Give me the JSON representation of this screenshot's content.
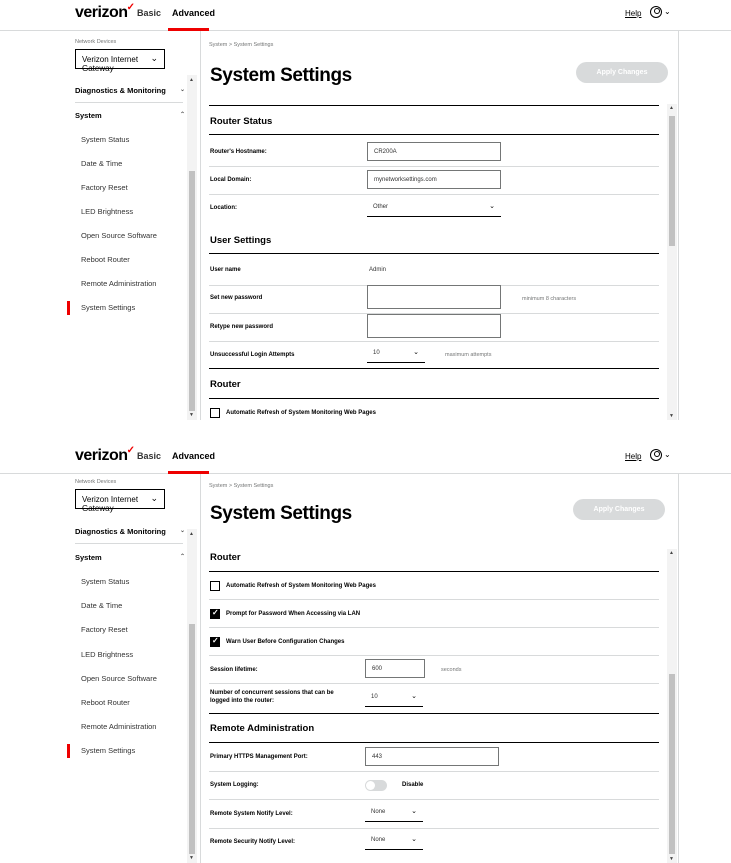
{
  "header": {
    "logo": "verizon",
    "logo_check": "✓",
    "nav_basic": "Basic",
    "nav_advanced": "Advanced",
    "help": "Help",
    "user_chevron": "⌄"
  },
  "sidebar": {
    "network_devices_label": "Network Devices",
    "network_device_selected": "Verizon Internet Gateway",
    "groups": [
      {
        "label": "Diagnostics & Monitoring",
        "expanded": false
      },
      {
        "label": "System",
        "expanded": true
      }
    ],
    "items": [
      {
        "label": "System Status"
      },
      {
        "label": "Date & Time"
      },
      {
        "label": "Factory Reset"
      },
      {
        "label": "LED Brightness"
      },
      {
        "label": "Open Source Software"
      },
      {
        "label": "Reboot Router"
      },
      {
        "label": "Remote Administration"
      },
      {
        "label": "System Settings",
        "active": true
      }
    ]
  },
  "main": {
    "breadcrumb": "System  >  System Settings",
    "title": "System Settings",
    "apply_button": "Apply Changes"
  },
  "view1": {
    "router_status_title": "Router Status",
    "hostname_label": "Router's Hostname:",
    "hostname_value": "CR200A",
    "domain_label": "Local Domain:",
    "domain_value": "mynetworksettings.com",
    "location_label": "Location:",
    "location_value": "Other",
    "user_settings_title": "User Settings",
    "username_label": "User name",
    "username_value": "Admin",
    "new_password_label": "Set new password",
    "new_password_hint": "minimum 8 characters",
    "retype_password_label": "Retype new password",
    "login_attempts_label": "Unsuccessful Login Attempts",
    "login_attempts_value": "10",
    "login_attempts_hint": "maximum attempts",
    "router_title": "Router",
    "auto_refresh_label": "Automatic Refresh of System Monitoring Web Pages"
  },
  "view2": {
    "router_title": "Router",
    "auto_refresh_label": "Automatic Refresh of System Monitoring Web Pages",
    "auto_refresh_checked": false,
    "prompt_password_label": "Prompt for Password When Accessing via LAN",
    "prompt_password_checked": true,
    "warn_user_label": "Warn User Before Configuration Changes",
    "warn_user_checked": true,
    "session_lifetime_label": "Session lifetime:",
    "session_lifetime_value": "600",
    "session_lifetime_unit": "seconds",
    "concurrent_label_line1": "Number of concurrent sessions that can be",
    "concurrent_label_line2": "logged into the router:",
    "concurrent_value": "10",
    "remote_admin_title": "Remote Administration",
    "https_port_label": "Primary HTTPS Management Port:",
    "https_port_value": "443",
    "logging_label": "System Logging:",
    "logging_state": "Disable",
    "notify_level_label": "Remote System Notify Level:",
    "notify_level_value": "None",
    "security_level_label": "Remote Security Notify Level:",
    "security_level_value": "None"
  },
  "icons": {
    "user": "user-circle-icon",
    "chevron": "chevron-down-icon",
    "checkbox": "checkbox-icon"
  },
  "colors": {
    "brand_red": "#ee0000",
    "button_disabled": "#d8dadb",
    "divider": "#d8dadb",
    "muted_text": "#747676"
  }
}
